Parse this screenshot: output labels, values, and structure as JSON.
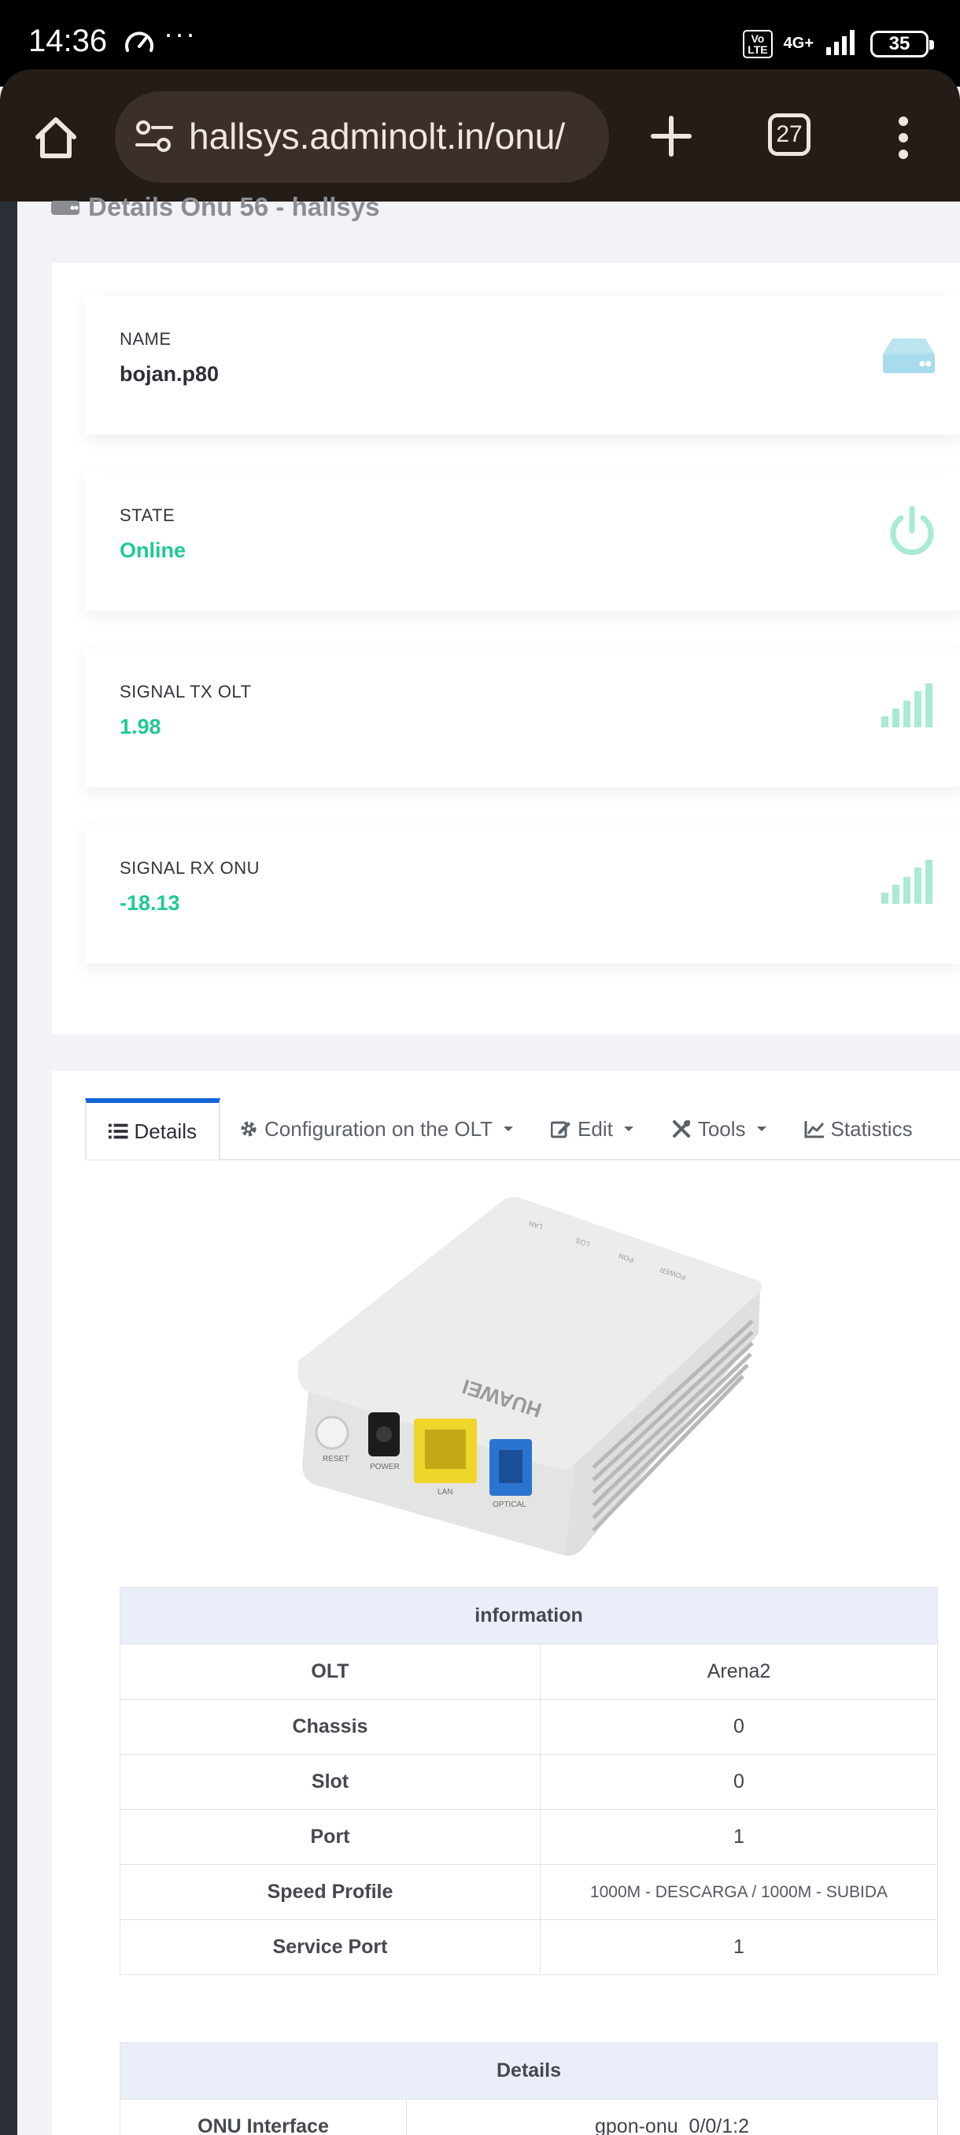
{
  "status_bar": {
    "time": "14:36",
    "dots": "···",
    "volte": "Vo\nLTE",
    "network": "4G+",
    "battery": "35"
  },
  "browser": {
    "url": "hallsys.adminolt.in/onu/",
    "tab_count": "27"
  },
  "page": {
    "heading": "Details Onu 56 - hallsys"
  },
  "stats": [
    {
      "label": "NAME",
      "value": "bojan.p80",
      "icon": "server-icon"
    },
    {
      "label": "STATE",
      "value": "Online",
      "icon": "power-icon"
    },
    {
      "label": "SIGNAL TX OLT",
      "value": "1.98",
      "icon": "signal-icon"
    },
    {
      "label": "SIGNAL RX ONU",
      "value": "-18.13",
      "icon": "signal-icon"
    }
  ],
  "tabs": {
    "details": "Details",
    "config": "Configuration on the OLT",
    "edit": "Edit",
    "tools": "Tools",
    "statistics": "Statistics"
  },
  "device": {
    "brand": "HUAWEI",
    "port_labels": [
      "RESET",
      "POWER",
      "LAN",
      "OPTICAL"
    ],
    "led_labels": [
      "LAN",
      "LOS",
      "PON",
      "POWER"
    ]
  },
  "info_table": {
    "title": "information",
    "rows": [
      {
        "key": "OLT",
        "value": "Arena2"
      },
      {
        "key": "Chassis",
        "value": "0"
      },
      {
        "key": "Slot",
        "value": "0"
      },
      {
        "key": "Port",
        "value": "1"
      },
      {
        "key": "Speed Profile",
        "value": "1000M - DESCARGA / 1000M - SUBIDA"
      },
      {
        "key": "Service Port",
        "value": "1"
      }
    ]
  },
  "details_table": {
    "title": "Details",
    "rows": [
      {
        "key": "ONU Interface",
        "value": "gpon-onu_0/0/1:2"
      }
    ]
  },
  "colors": {
    "accent": "#1565d8",
    "success": "#20c997",
    "icon_muted": "#b9e4f0",
    "icon_green_muted": "#a9ead4"
  }
}
